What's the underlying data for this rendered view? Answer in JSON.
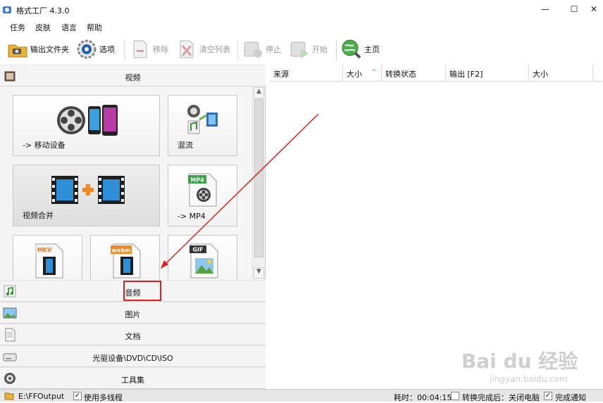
{
  "window": {
    "title": "格式工厂 4.3.0",
    "minimize_glyph": "—",
    "maximize_glyph": "☐",
    "close_glyph": "✕"
  },
  "menu": [
    "任务",
    "皮肤",
    "语言",
    "帮助"
  ],
  "toolbar": {
    "output_folder": "输出文件夹",
    "options": "选项",
    "remove": "移除",
    "clear_list": "清空列表",
    "stop": "停止",
    "start": "开始",
    "home": "主页"
  },
  "categories": {
    "video": "视频",
    "audio": "音频",
    "picture": "图片",
    "document": "文档",
    "optical": "光驱设备\\DVD\\CD\\ISO",
    "tools": "工具集"
  },
  "tiles": {
    "mobile": "-> 移动设备",
    "mux": "混流",
    "join": "视频合并",
    "mp4": "-> MP4",
    "mkv_badge": "MKV",
    "webm_badge": "webm",
    "gif_badge": "GIF",
    "mp4_badge": "MP4"
  },
  "list": {
    "columns": [
      "来源",
      "大小",
      "转换状态",
      "输出 [F2]",
      "大小"
    ],
    "sort_glyph": "^"
  },
  "status": {
    "output_path": "E:\\FFOutput",
    "multithread": "使用多线程",
    "elapsed": "耗时：00:04:15",
    "after_done": "转换完成后：关闭电脑",
    "notify": "完成通知"
  },
  "watermark": {
    "main": "Bai du 经验",
    "sub": "jingyan.baidu.com"
  },
  "colors": {
    "accent_red": "#e02020"
  }
}
